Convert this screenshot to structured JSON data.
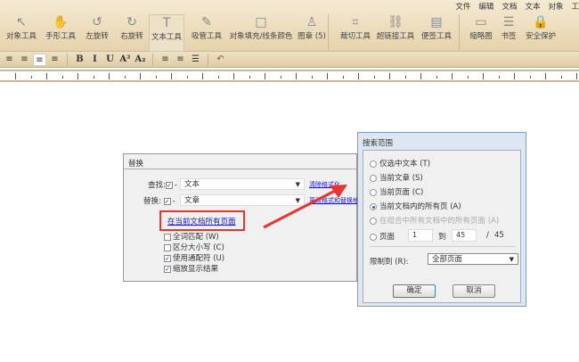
{
  "menu": [
    "文件",
    "编辑",
    "文档",
    "文本",
    "对象",
    "工"
  ],
  "tools": [
    {
      "label": "对象工具",
      "icon": "cursor-icon",
      "g": "↖"
    },
    {
      "label": "手形工具",
      "icon": "hand-icon",
      "g": "✋"
    },
    {
      "label": "左旋转",
      "icon": "rotate-left-icon",
      "g": "↺"
    },
    {
      "label": "右旋转",
      "icon": "rotate-right-icon",
      "g": "↻"
    },
    {
      "label": "文本工具",
      "icon": "text-icon",
      "g": "T"
    },
    {
      "label": "吸管工具",
      "icon": "eyedropper-icon",
      "g": "✎"
    },
    {
      "label": "对象填充/线条颜色",
      "icon": "fill-color-icon",
      "g": "□"
    },
    {
      "label": "图章 (5)",
      "icon": "stamp-icon",
      "g": "♙"
    },
    {
      "label": "裁切工具",
      "icon": "crop-icon",
      "g": "⌗"
    },
    {
      "label": "超链接工具",
      "icon": "link-icon",
      "g": "⛓"
    },
    {
      "label": "便签工具",
      "icon": "note-icon",
      "g": "▤"
    },
    {
      "label": "缩略图",
      "icon": "thumbnail-icon",
      "g": "▭"
    },
    {
      "label": "书签",
      "icon": "bookmark-list-icon",
      "g": "☰"
    },
    {
      "label": "安全保护",
      "icon": "lock-icon",
      "g": "🔒"
    }
  ],
  "format": [
    "≡",
    "≡",
    "≡",
    "≡",
    "B",
    "I",
    "U",
    "A²",
    "A₂",
    "≡",
    "≡",
    "☰",
    "↶"
  ],
  "replace": {
    "title": "替换",
    "find_label": "查找:",
    "find_value": "文本",
    "replace_label": "替换:",
    "replace_value": "文章",
    "link1": "清除格式化",
    "link2": "更改格式和替换格式",
    "scope_link": "在当前文档所有页面",
    "options": [
      {
        "label": "全词匹配 (W)",
        "checked": false
      },
      {
        "label": "区分大小写 (C)",
        "checked": false
      },
      {
        "label": "使用通配符 (U)",
        "checked": true
      },
      {
        "label": "缩放显示结果",
        "checked": true
      }
    ]
  },
  "scope": {
    "title": "搜索范围",
    "options": [
      {
        "label": "仅选中文本 (T)",
        "selected": false,
        "disabled": false
      },
      {
        "label": "当前文章 (S)",
        "selected": false,
        "disabled": false
      },
      {
        "label": "当前页面 (C)",
        "selected": false,
        "disabled": false
      },
      {
        "label": "当前文档内的所有页 (A)",
        "selected": true,
        "disabled": false
      },
      {
        "label": "在组合中所有文档中的所有页面 (A)",
        "selected": false,
        "disabled": true
      }
    ],
    "page_label": "页面",
    "from": "1",
    "to_label": "到",
    "to": "45",
    "slash": "/",
    "total": "45",
    "limit_label": "限制到 (R):",
    "limit_value": "全部页面",
    "ok": "确定",
    "cancel": "取消"
  },
  "accent": "#e8352f"
}
